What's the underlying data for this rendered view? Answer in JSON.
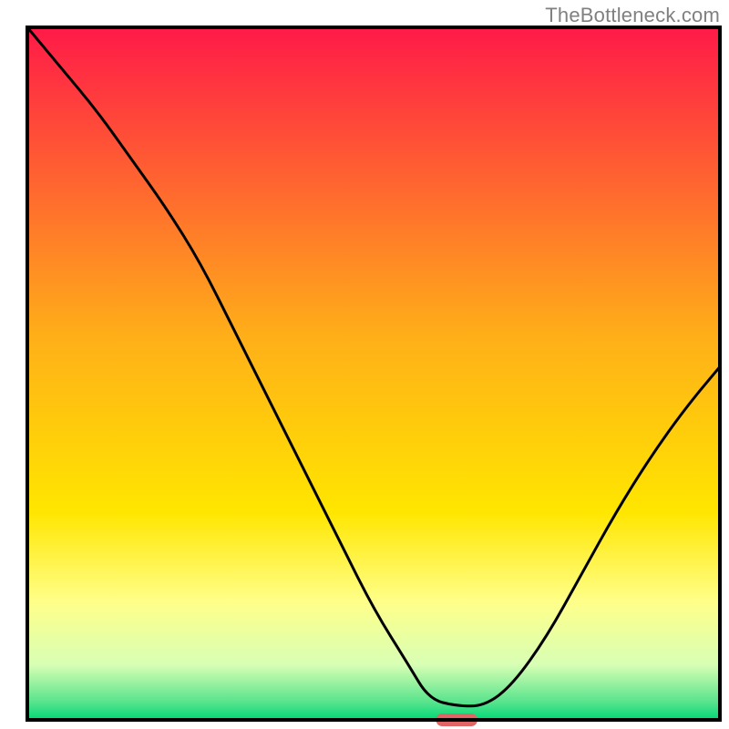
{
  "attribution": "TheBottleneck.com",
  "chart_data": {
    "type": "line",
    "title": "",
    "xlabel": "",
    "ylabel": "",
    "xlim": [
      0,
      100
    ],
    "ylim": [
      0,
      100
    ],
    "grid": false,
    "legend": false,
    "background_gradient": {
      "stops": [
        {
          "offset": 0.0,
          "color": "#ff1a48"
        },
        {
          "offset": 0.45,
          "color": "#ffb018"
        },
        {
          "offset": 0.7,
          "color": "#ffe600"
        },
        {
          "offset": 0.83,
          "color": "#ffff8a"
        },
        {
          "offset": 0.92,
          "color": "#d8ffb4"
        },
        {
          "offset": 0.975,
          "color": "#56e38c"
        },
        {
          "offset": 1.0,
          "color": "#00d977"
        }
      ]
    },
    "curve": {
      "x": [
        0,
        5,
        10,
        15,
        20,
        25,
        30,
        35,
        40,
        45,
        50,
        55,
        58,
        62,
        66,
        70,
        75,
        80,
        85,
        90,
        95,
        100
      ],
      "y": [
        100,
        94,
        88,
        81,
        74,
        66,
        56,
        46,
        36,
        26,
        16,
        8,
        3,
        2,
        2,
        5,
        12,
        21,
        30,
        38,
        45,
        51
      ]
    },
    "optimal_marker": {
      "x_center": 62,
      "width": 6,
      "color": "#e06666"
    }
  }
}
